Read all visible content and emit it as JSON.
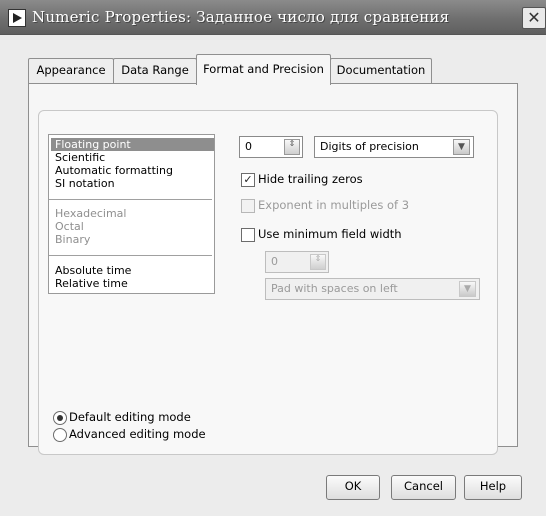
{
  "window": {
    "title": "Numeric Properties: Заданное число для сравнения",
    "close_glyph": "✕"
  },
  "tabs": [
    {
      "label": "Appearance",
      "active": false
    },
    {
      "label": "Data Range",
      "active": false
    },
    {
      "label": "Format and Precision",
      "active": true
    },
    {
      "label": "Documentation",
      "active": false
    }
  ],
  "format_list": {
    "groups": [
      {
        "items": [
          {
            "label": "Floating point",
            "selected": true,
            "enabled": true
          },
          {
            "label": "Scientific",
            "selected": false,
            "enabled": true
          },
          {
            "label": "Automatic formatting",
            "selected": false,
            "enabled": true
          },
          {
            "label": "SI notation",
            "selected": false,
            "enabled": true
          }
        ]
      },
      {
        "items": [
          {
            "label": "Hexadecimal",
            "selected": false,
            "enabled": false
          },
          {
            "label": "Octal",
            "selected": false,
            "enabled": false
          },
          {
            "label": "Binary",
            "selected": false,
            "enabled": false
          }
        ]
      },
      {
        "items": [
          {
            "label": "Absolute time",
            "selected": false,
            "enabled": true
          },
          {
            "label": "Relative time",
            "selected": false,
            "enabled": true
          }
        ]
      }
    ]
  },
  "precision": {
    "digits_value": "0",
    "mode_selected": "Digits of precision"
  },
  "options": {
    "hide_trailing_zeros": {
      "label": "Hide trailing zeros",
      "checked": true,
      "enabled": true
    },
    "exponent_multiples_of_3": {
      "label": "Exponent in multiples of 3",
      "checked": false,
      "enabled": false
    },
    "use_min_field_width": {
      "label": "Use minimum field width",
      "checked": false,
      "enabled": true
    }
  },
  "field_width": {
    "value": "0",
    "pad_selected": "Pad with spaces on left"
  },
  "editing_mode": {
    "default_label": "Default editing mode",
    "advanced_label": "Advanced editing mode",
    "selected": "default"
  },
  "buttons": {
    "ok": "OK",
    "cancel": "Cancel",
    "help": "Help"
  },
  "icons": {
    "check": "✓",
    "spin": "⇕",
    "dropdown": "▼"
  }
}
